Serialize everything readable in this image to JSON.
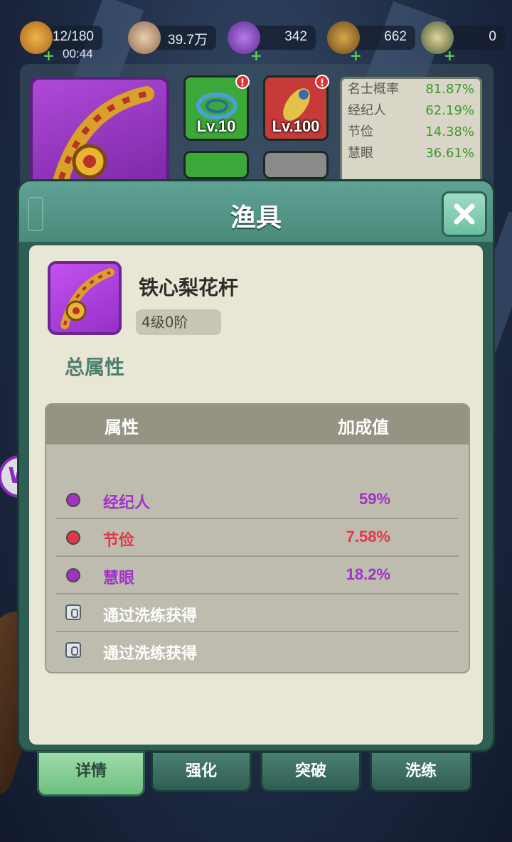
{
  "resources": {
    "energy": {
      "value": "12/180",
      "timer": "00:44",
      "icon": "bread-icon",
      "has_plus": true
    },
    "coins": {
      "value": "39.7万",
      "icon": "coin-icon",
      "has_plus": false
    },
    "gems": {
      "value": "342",
      "icon": "purple-gem-icon",
      "has_plus": true
    },
    "chests": {
      "value": "662",
      "icon": "treasure-box-icon",
      "has_plus": true
    },
    "tridents": {
      "value": "0",
      "icon": "trident-icon",
      "has_plus": true
    }
  },
  "equipment_panel": {
    "slots": [
      {
        "label": "Lv.10",
        "color": "#3da83a",
        "alert": "!"
      },
      {
        "label": "Lv.100",
        "color": "#c63a3a",
        "alert": "!"
      }
    ],
    "stats": [
      {
        "name": "名士概率",
        "value": "81.87%"
      },
      {
        "name": "经纪人",
        "value": "62.19%"
      },
      {
        "name": "节俭",
        "value": "14.38%"
      },
      {
        "name": "慧眼",
        "value": "36.61%"
      }
    ]
  },
  "modal": {
    "title": "渔具",
    "item": {
      "name": "铁心梨花杆",
      "level": "4级0阶",
      "icon": "fishing-rod-icon"
    },
    "section_title": "总属性",
    "table": {
      "headers": {
        "attribute": "属性",
        "bonus": "加成值"
      },
      "rows": [
        {
          "name": "经纪人",
          "value": "59%",
          "color": "#a330c8"
        },
        {
          "name": "节俭",
          "value": "7.58%",
          "color": "#e0384a"
        },
        {
          "name": "慧眼",
          "value": "18.2%",
          "color": "#a330c8"
        }
      ],
      "locked_rows": [
        {
          "text": "通过洗练获得"
        },
        {
          "text": "通过洗练获得"
        }
      ]
    }
  },
  "tabs": [
    {
      "label": "详情",
      "active": true
    },
    {
      "label": "强化",
      "active": false
    },
    {
      "label": "突破",
      "active": false
    },
    {
      "label": "洗练",
      "active": false
    }
  ],
  "side_widget": {
    "label": "W"
  }
}
